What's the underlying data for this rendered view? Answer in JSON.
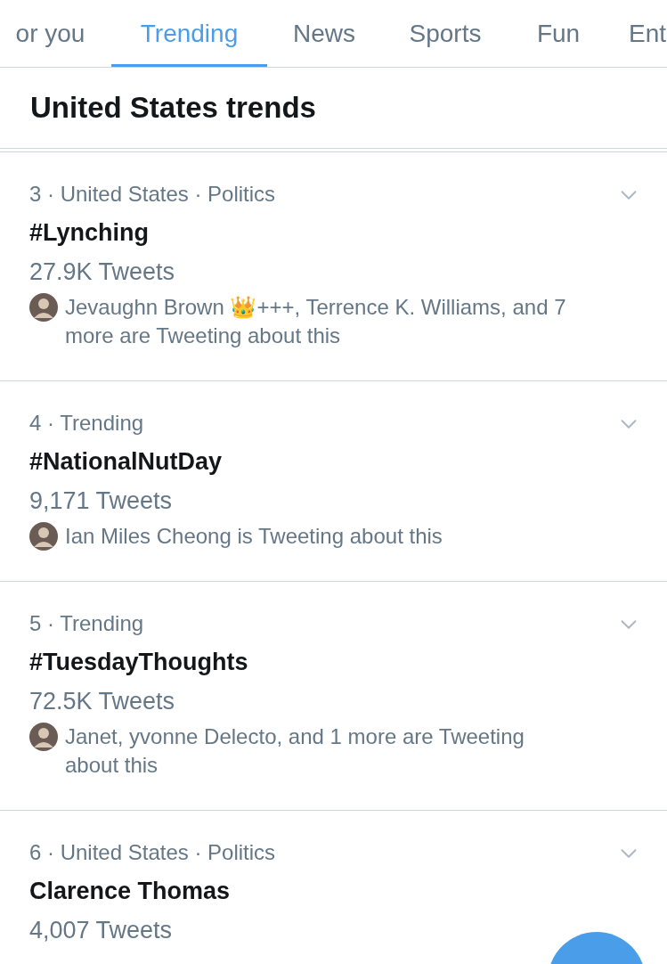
{
  "tabs": [
    {
      "label": "or you",
      "selected": false
    },
    {
      "label": "Trending",
      "selected": true
    },
    {
      "label": "News",
      "selected": false
    },
    {
      "label": "Sports",
      "selected": false
    },
    {
      "label": "Fun",
      "selected": false
    },
    {
      "label": "Ent",
      "selected": false
    }
  ],
  "header": "United States trends",
  "trends": [
    {
      "meta": "3 · United States · Politics",
      "title": "#Lynching",
      "count": "27.9K Tweets",
      "context": "Jevaughn Brown 👑+++, Terrence K. Williams, and 7 more are Tweeting about this"
    },
    {
      "meta": "4 · Trending",
      "title": "#NationalNutDay",
      "count": "9,171 Tweets",
      "context": "Ian Miles Cheong is Tweeting about this"
    },
    {
      "meta": "5 · Trending",
      "title": "#TuesdayThoughts",
      "count": "72.5K Tweets",
      "context": "Janet, yvonne Delecto, and 1 more are Tweeting about this"
    },
    {
      "meta": "6 · United States · Politics",
      "title": "Clarence Thomas",
      "count": "4,007 Tweets"
    }
  ]
}
